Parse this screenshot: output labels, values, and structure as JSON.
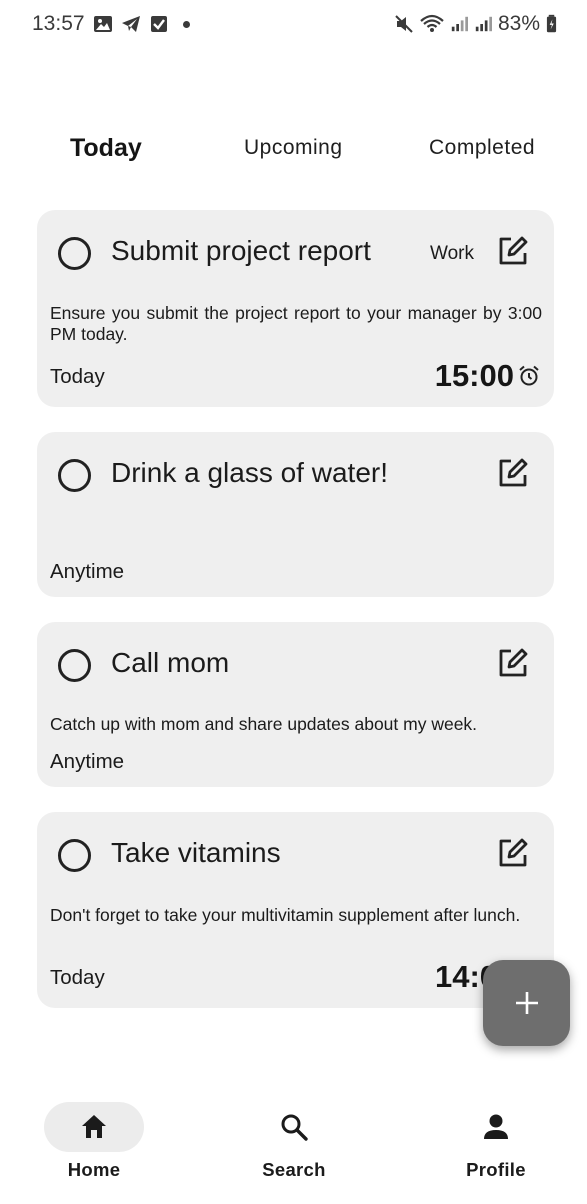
{
  "status_bar": {
    "time": "13:57",
    "battery": "83%",
    "left_icons": [
      "gallery-icon",
      "telegram-icon",
      "checkbox-icon",
      "dot-icon"
    ],
    "right_icons": [
      "mute-icon",
      "wifi-icon",
      "signal-icon",
      "signal-icon",
      "battery-icon"
    ]
  },
  "tabs": [
    {
      "label": "Today",
      "active": true
    },
    {
      "label": "Upcoming",
      "active": false
    },
    {
      "label": "Completed",
      "active": false
    }
  ],
  "tasks": [
    {
      "title": "Submit project report",
      "category": "Work",
      "description": "Ensure you submit the project report to your manager by 3:00 PM today.",
      "when": "Today",
      "time": "15:00"
    },
    {
      "title": "Drink a glass of water!",
      "when": "Anytime"
    },
    {
      "title": "Call mom",
      "description": "Catch up with mom and share updates about my week.",
      "when": "Anytime"
    },
    {
      "title": "Take vitamins",
      "description": "Don't forget to take your multivitamin supplement after lunch.",
      "when": "Today",
      "time": "14:00"
    }
  ],
  "fab": {
    "icon": "plus-icon"
  },
  "bottom_nav": [
    {
      "label": "Home",
      "icon": "home-icon",
      "selected": true
    },
    {
      "label": "Search",
      "icon": "search-icon",
      "selected": false
    },
    {
      "label": "Profile",
      "icon": "person-icon",
      "selected": false
    }
  ],
  "colors": {
    "card_background": "#efefef",
    "fab_background": "#6e6e6e",
    "nav_selected_pill": "#ececec"
  }
}
